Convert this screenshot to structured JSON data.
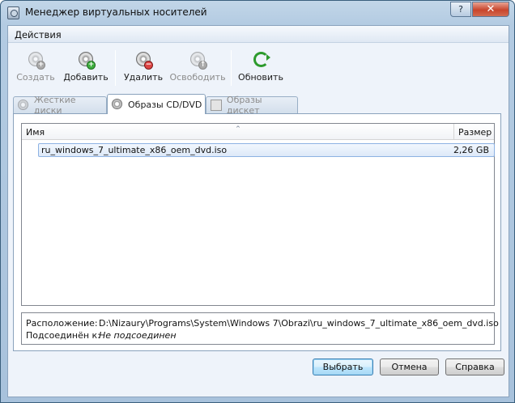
{
  "window": {
    "title": "Менеджер виртуальных носителей",
    "help_button": "?",
    "close_button": "✕"
  },
  "menu": {
    "items": [
      {
        "label": "Действия"
      }
    ]
  },
  "toolbar": {
    "buttons": [
      {
        "label": "Создать",
        "icon": "disk-new-icon",
        "enabled": false
      },
      {
        "label": "Добавить",
        "icon": "disk-add-icon",
        "enabled": true
      },
      {
        "label": "Удалить",
        "icon": "disk-remove-icon",
        "enabled": true
      },
      {
        "label": "Освободить",
        "icon": "disk-release-icon",
        "enabled": false
      },
      {
        "label": "Обновить",
        "icon": "refresh-icon",
        "enabled": true
      }
    ]
  },
  "tabs": [
    {
      "label": "Жесткие диски",
      "active": false,
      "enabled": false
    },
    {
      "label": "Образы CD/DVD",
      "active": true,
      "enabled": true
    },
    {
      "label": "Образы дискет",
      "active": false,
      "enabled": false
    }
  ],
  "list": {
    "columns": {
      "name": "Имя",
      "size": "Размер"
    },
    "sort_indicator": "^",
    "rows": [
      {
        "name": "ru_windows_7_ultimate_x86_oem_dvd.iso",
        "size": "2,26 GB",
        "selected": true
      }
    ]
  },
  "details": {
    "location_label": "Расположение:",
    "location_value": "D:\\Nizaury\\Programs\\System\\Windows 7\\Obrazi\\ru_windows_7_ultimate_x86_oem_dvd.iso",
    "attached_label": "Подсоединён к:",
    "attached_value": "Не подсоединен"
  },
  "buttons": {
    "select": "Выбрать",
    "cancel": "Отмена",
    "help": "Справка"
  },
  "colors": {
    "title_bar": "#b3cbe2",
    "close_button": "#c8452c",
    "selection": "#dde9f8",
    "default_button": "#bee6fd"
  }
}
